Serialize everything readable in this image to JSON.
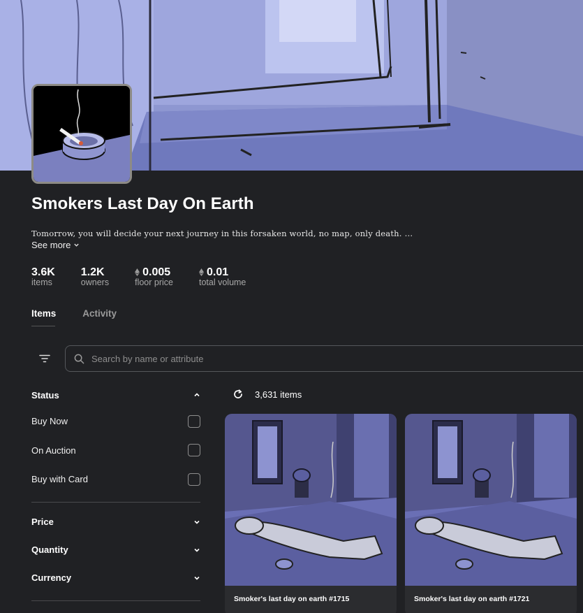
{
  "collection": {
    "name": "Smokers Last Day On Earth",
    "description": "Tomorrow, you will decide your next journey in this forsaken world, no map, only death.",
    "ellipsis": "...",
    "see_more": "See more"
  },
  "stats": [
    {
      "value": "3.6K",
      "label": "items",
      "eth": false
    },
    {
      "value": "1.2K",
      "label": "owners",
      "eth": false
    },
    {
      "value": "0.005",
      "label": "floor price",
      "eth": true
    },
    {
      "value": "0.01",
      "label": "total volume",
      "eth": true
    }
  ],
  "tabs": [
    {
      "label": "Items",
      "active": true
    },
    {
      "label": "Activity",
      "active": false
    }
  ],
  "search": {
    "placeholder": "Search by name or attribute"
  },
  "filters": {
    "status": {
      "title": "Status",
      "options": [
        "Buy Now",
        "On Auction",
        "Buy with Card"
      ]
    },
    "price": "Price",
    "quantity": "Quantity",
    "currency": "Currency"
  },
  "results": {
    "count": "3,631 items"
  },
  "cards": [
    {
      "name": "Smoker's last day on earth #1715"
    },
    {
      "name": "Smoker's last day on earth #1721"
    }
  ],
  "icons": {
    "filter": "filter-icon",
    "search": "search-icon",
    "refresh": "refresh-icon",
    "eth": "eth-icon",
    "chevron_up": "chevron-up-icon",
    "chevron_down": "chevron-down-icon"
  },
  "colors": {
    "background": "#202124",
    "banner": "#7f8bc9",
    "room": "#6a6fa8",
    "muted_text": "#a8a8a8"
  }
}
